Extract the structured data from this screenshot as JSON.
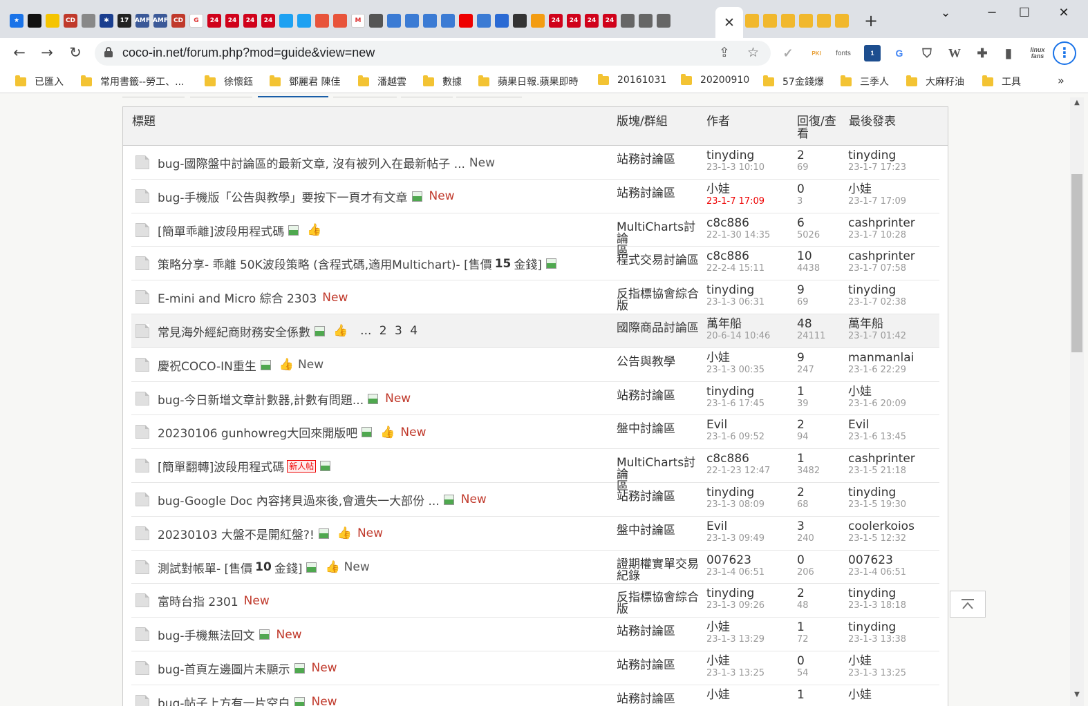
{
  "browser": {
    "active_tab_close": "✕",
    "new_tab": "+",
    "window_controls": [
      "⌄",
      "─",
      "☐",
      "✕"
    ],
    "url": "coco-in.net/forum.php?mod=guide&view=new",
    "extensions": {
      "fonts": "fonts",
      "linux": "linux fans",
      "notif_count": "1"
    },
    "tab_favicons_left": [
      "★",
      "",
      "",
      "CD",
      "",
      "✱",
      "17",
      "AMF",
      "AMF",
      "CD",
      "G",
      "24",
      "24",
      "24",
      "24",
      "",
      "",
      "",
      "",
      "M",
      "",
      "",
      "",
      "",
      "",
      "",
      "",
      "",
      "",
      "",
      "24",
      "24",
      "24",
      "24",
      "",
      "",
      ""
    ],
    "tab_favicons_right": [
      "",
      "",
      "",
      "",
      "",
      ""
    ]
  },
  "bookmarks": [
    "已匯入",
    "常用書籤--勞工、...",
    "徐懷鈺",
    "鄧麗君 陳佳",
    "潘越雲",
    "數據",
    "蘋果日報.蘋果即時",
    "20161031",
    "20200910",
    "57金錢爆",
    "三季人",
    "大麻籽油",
    "工具"
  ],
  "table": {
    "headers": {
      "title": "標題",
      "forum": "版塊/群組",
      "author": "作者",
      "replies_l1": "回復/查",
      "replies_l2": "看",
      "last": "最後發表"
    },
    "rows": [
      {
        "title": "bug-國際盤中討論區的最新文章, 沒有被列入在最新帖子 ...",
        "new": "New",
        "new_style": "gray",
        "forum_l1": "站務討論區",
        "forum_l2": "",
        "author": "tinyding",
        "author_date": "23-1-3 10:10",
        "replies": "2",
        "views": "69",
        "last_author": "tinyding",
        "last_date": "23-1-7 17:23"
      },
      {
        "title": "bug-手機版「公告與教學」要按下一頁才有文章",
        "img": true,
        "new": "New",
        "new_style": "red",
        "forum_l1": "站務討論區",
        "forum_l2": "",
        "author": "小娃",
        "author_date": "23-1-7 17:09",
        "author_date_red": true,
        "replies": "0",
        "views": "3",
        "last_author": "小娃",
        "last_date": "23-1-7 17:09"
      },
      {
        "title": "[簡單乖離]波段用程式碼",
        "img": true,
        "thumb": true,
        "forum_l1": "MultiCharts討論",
        "forum_l2": "區",
        "author": "c8c886",
        "author_date": "22-1-30 14:35",
        "replies": "6",
        "views": "5026",
        "last_author": "cashprinter",
        "last_date": "23-1-7 10:28"
      },
      {
        "title": "策略分享- 乖離 50K波段策略 (含程式碼,適用Multichart)- [售價 ",
        "bold": "15",
        "suffix": " 金錢]",
        "img": true,
        "forum_l1": "程式交易討論區",
        "forum_l2": "",
        "author": "c8c886",
        "author_date": "22-2-4 15:11",
        "replies": "10",
        "views": "4438",
        "last_author": "cashprinter",
        "last_date": "23-1-7 07:58"
      },
      {
        "title": "E-mini and Micro 綜合 2303",
        "new": "New",
        "new_style": "red",
        "forum_l1": "反指標協會綜合",
        "forum_l2": "版",
        "author": "tinyding",
        "author_date": "23-1-3 06:31",
        "replies": "9",
        "views": "69",
        "last_author": "tinyding",
        "last_date": "23-1-7 02:38"
      },
      {
        "title": "常見海外經紀商財務安全係數",
        "img": true,
        "thumb": true,
        "pages": "... 2  3  4",
        "forum_l1": "國際商品討論區",
        "forum_l2": "",
        "author": "萬年船",
        "author_date": "20-6-14 10:46",
        "replies": "48",
        "views": "24111",
        "last_author": "萬年船",
        "last_date": "23-1-7 01:42",
        "highlight": true
      },
      {
        "title": "慶祝COCO-IN重生",
        "img": true,
        "thumb": true,
        "new": "New",
        "new_style": "gray",
        "forum_l1": "公告與教學",
        "forum_l2": "",
        "author": "小娃",
        "author_date": "23-1-3 00:35",
        "replies": "9",
        "views": "247",
        "last_author": "manmanlai",
        "last_date": "23-1-6 22:29"
      },
      {
        "title": "bug-今日新增文章計數器,計數有問題...",
        "img": true,
        "new": "New",
        "new_style": "red",
        "forum_l1": "站務討論區",
        "forum_l2": "",
        "author": "tinyding",
        "author_date": "23-1-6 17:45",
        "replies": "1",
        "views": "39",
        "last_author": "小娃",
        "last_date": "23-1-6 20:09"
      },
      {
        "title": "20230106 gunhowreg大回來開版吧",
        "img": true,
        "thumb": true,
        "new": "New",
        "new_style": "red",
        "forum_l1": "盤中討論區",
        "forum_l2": "",
        "author": "Evil",
        "author_date": "23-1-6 09:52",
        "replies": "2",
        "views": "94",
        "last_author": "Evil",
        "last_date": "23-1-6 13:45"
      },
      {
        "title": "[簡單翻轉]波段用程式碼",
        "newbie": "新人帖",
        "img": true,
        "forum_l1": "MultiCharts討論",
        "forum_l2": "區",
        "author": "c8c886",
        "author_date": "22-1-23 12:47",
        "replies": "1",
        "views": "3482",
        "last_author": "cashprinter",
        "last_date": "23-1-5 21:18"
      },
      {
        "title": "bug-Google Doc 內容拷貝過來後,會遺失一大部份 ...",
        "img": true,
        "new": "New",
        "new_style": "red",
        "forum_l1": "站務討論區",
        "forum_l2": "",
        "author": "tinyding",
        "author_date": "23-1-3 08:09",
        "replies": "2",
        "views": "68",
        "last_author": "tinyding",
        "last_date": "23-1-5 19:30"
      },
      {
        "title": "20230103 大盤不是開紅盤?!",
        "img": true,
        "thumb": true,
        "new": "New",
        "new_style": "red",
        "forum_l1": "盤中討論區",
        "forum_l2": "",
        "author": "Evil",
        "author_date": "23-1-3 09:49",
        "replies": "3",
        "views": "240",
        "last_author": "coolerkoios",
        "last_date": "23-1-5 12:32"
      },
      {
        "title": "測試對帳單- [售價 ",
        "bold": "10",
        "suffix": " 金錢]",
        "img": true,
        "thumb": true,
        "new": "New",
        "new_style": "gray",
        "forum_l1": "證期權實單交易",
        "forum_l2": "紀錄",
        "author": "007623",
        "author_date": "23-1-4 06:51",
        "replies": "0",
        "views": "206",
        "last_author": "007623",
        "last_date": "23-1-4 06:51"
      },
      {
        "title": "富時台指 2301",
        "new": "New",
        "new_style": "red",
        "forum_l1": "反指標協會綜合",
        "forum_l2": "版",
        "author": "tinyding",
        "author_date": "23-1-3 09:26",
        "replies": "2",
        "views": "48",
        "last_author": "tinyding",
        "last_date": "23-1-3 18:18"
      },
      {
        "title": "bug-手機無法回文",
        "img": true,
        "new": "New",
        "new_style": "red",
        "forum_l1": "站務討論區",
        "forum_l2": "",
        "author": "小娃",
        "author_date": "23-1-3 13:29",
        "replies": "1",
        "views": "72",
        "last_author": "tinyding",
        "last_date": "23-1-3 13:38"
      },
      {
        "title": "bug-首頁左邊圖片未顯示",
        "img": true,
        "new": "New",
        "new_style": "red",
        "forum_l1": "站務討論區",
        "forum_l2": "",
        "author": "小娃",
        "author_date": "23-1-3 13:25",
        "replies": "0",
        "views": "54",
        "last_author": "小娃",
        "last_date": "23-1-3 13:25"
      },
      {
        "title": "bug-帖子上方有一片空白",
        "img": true,
        "new": "New",
        "new_style": "red",
        "forum_l1": "站務討論區",
        "forum_l2": "",
        "author": "小娃",
        "author_date": "",
        "replies": "1",
        "views": "",
        "last_author": "小娃",
        "last_date": ""
      }
    ]
  },
  "scroll_top_icon": "⇱"
}
